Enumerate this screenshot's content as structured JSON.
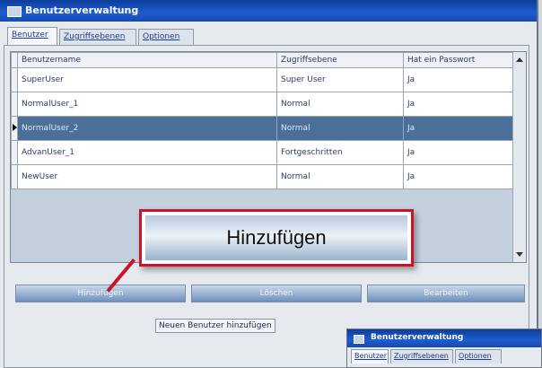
{
  "window": {
    "title": "Benutzerverwaltung",
    "tabs": [
      "Benutzer",
      "Zugriffsebenen",
      "Optionen"
    ]
  },
  "grid": {
    "columns": [
      "Benutzername",
      "Zugriffsebene",
      "Hat ein Passwort"
    ],
    "rows": [
      [
        "SuperUser",
        "Super User",
        "Ja"
      ],
      [
        "NormalUser_1",
        "Normal",
        "Ja"
      ],
      [
        "NormalUser_2",
        "Normal",
        "Ja"
      ],
      [
        "AdvanUser_1",
        "Fortgeschritten",
        "Ja"
      ],
      [
        "NewUser",
        "Normal",
        "Ja"
      ]
    ],
    "selected_row": 2
  },
  "buttons": {
    "add": "Hinzufügen",
    "delete": "Löschen",
    "edit": "Bearbeiten"
  },
  "tooltip_button": "Neuen Benutzer hinzufügen",
  "callout": {
    "label": "Hinzufügen"
  },
  "colors": {
    "callout_border": "#c8152c",
    "title_bar": "#1e5dd0",
    "selected_row": "#4a6f99"
  }
}
